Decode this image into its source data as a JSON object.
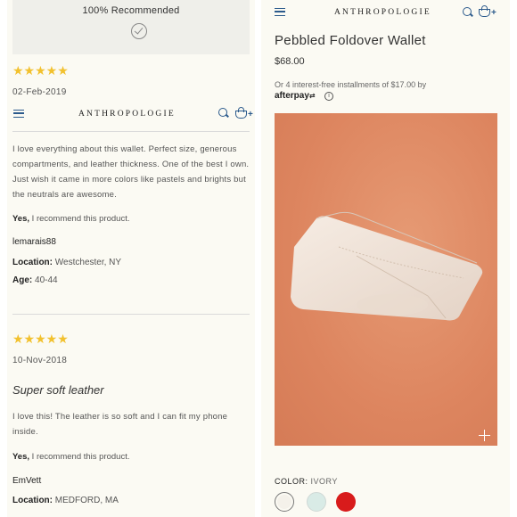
{
  "left": {
    "recommended_text": "100% Recommended",
    "review1": {
      "stars": "★★★★★",
      "date": "02-Feb-2019",
      "body": "I love everything about this wallet. Perfect size, generous compartments, and leather thickness. One of the best I own. Just wish it came in more colors like pastels and brights but the neutrals are awesome.",
      "recommend_yes": "Yes,",
      "recommend_text": "I recommend this product.",
      "user": "lemarais88",
      "location_label": "Location:",
      "location": "Westchester, NY",
      "age_label": "Age:",
      "age": "40-44"
    },
    "review2": {
      "stars": "★★★★★",
      "date": "10-Nov-2018",
      "title": "Super soft leather",
      "body": "I love this! The leather is so soft and I can fit my phone inside.",
      "recommend_yes": "Yes,",
      "recommend_text": "I recommend this product.",
      "user": "EmVett",
      "location_label": "Location:",
      "location": "MEDFORD, MA"
    }
  },
  "header": {
    "logo": "ANTHROPOLOGIE"
  },
  "right": {
    "title": "Pebbled Foldover Wallet",
    "price": "$68.00",
    "installments": "Or 4 interest-free installments of $17.00 by",
    "afterpay": "afterpay",
    "color_label": "COLOR:",
    "color_value": "IVORY",
    "swatches": [
      {
        "name": "ivory",
        "color": "#f4f1ea"
      },
      {
        "name": "mint",
        "color": "#d9ebe6"
      },
      {
        "name": "red",
        "color": "#d81b1b"
      }
    ]
  },
  "colors": {
    "accent": "#2b5a8c",
    "star": "#f2c12e",
    "panel_bg": "#fbfaf3",
    "photo_bg": "#dd855f"
  }
}
